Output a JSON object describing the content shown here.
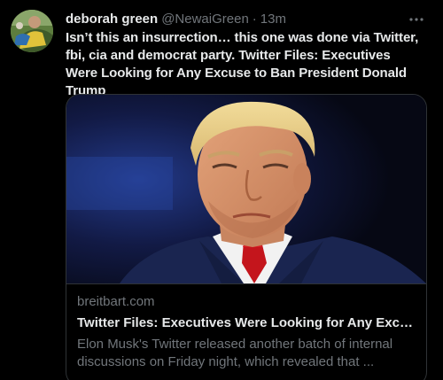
{
  "tweet": {
    "display_name": "deborah green",
    "handle": "@NewaiGreen",
    "separator": "·",
    "time": "13m",
    "text": "Isn’t this an insurrection… this one was done via Twitter, fbi, cia and democrat party. Twitter Files: Executives Were Looking for Any Excuse to Ban President Donald Trump",
    "avatar_icon": "user-avatar-photo",
    "more_icon": "more-horizontal-icon"
  },
  "card": {
    "domain": "breitbart.com",
    "title": "Twitter Files: Executives Were Looking for Any Excuse to Ban President Donald Trump",
    "description": "Elon Musk's Twitter released another batch of internal discussions on Friday night, which revealed that ...",
    "image_icon": "article-photo-man-portrait"
  },
  "colors": {
    "background": "#000000",
    "primary_text": "#e7e9ea",
    "secondary_text": "#71767b",
    "border": "#2f3336"
  }
}
